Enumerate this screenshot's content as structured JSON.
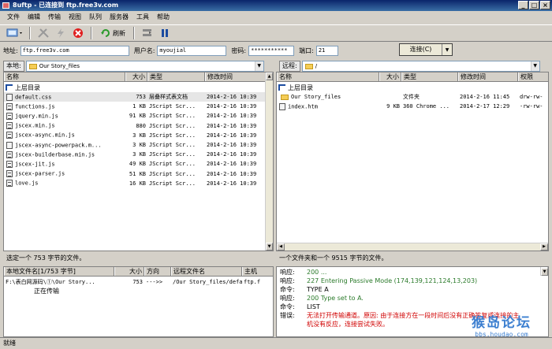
{
  "window": {
    "title": "8uftp - 已连接到 ftp.free3v.com",
    "min": "_",
    "max": "□",
    "close": "×"
  },
  "menu": [
    "文件",
    "编辑",
    "传输",
    "视图",
    "队列",
    "服务器",
    "工具",
    "帮助"
  ],
  "toolbar": {
    "refresh_label": "刷新"
  },
  "addressbar": {
    "address_label": "地址:",
    "address_value": "ftp.free3v.com",
    "user_label": "用户名:",
    "user_value": "myoujial",
    "password_label": "密码:",
    "password_value": "***********",
    "port_label": "端口:",
    "port_value": "21",
    "connect_label": "连接(C)"
  },
  "local": {
    "path_label": "本地:",
    "path_value": "Our Story_files",
    "columns": [
      "名称",
      "大小",
      "类型",
      "修改时间"
    ],
    "up_label": "上层目录",
    "files": [
      {
        "name": "default.css",
        "size": "753",
        "type": "层叠样式表文档",
        "date": "2014-2-16 10:39"
      },
      {
        "name": "functions.js",
        "size": "1 KB",
        "type": "JScript Scr...",
        "date": "2014-2-16 10:39"
      },
      {
        "name": "jquery.min.js",
        "size": "91 KB",
        "type": "JScript Scr...",
        "date": "2014-2-16 10:39"
      },
      {
        "name": "jscex.min.js",
        "size": "880",
        "type": "JScript Scr...",
        "date": "2014-2-16 10:39"
      },
      {
        "name": "jscex-async.min.js",
        "size": "3 KB",
        "type": "JScript Scr...",
        "date": "2014-2-16 10:39"
      },
      {
        "name": "jscex-async-powerpack.m...",
        "size": "3 KB",
        "type": "JScript Scr...",
        "date": "2014-2-16 10:39"
      },
      {
        "name": "jscex-builderbase.min.js",
        "size": "3 KB",
        "type": "JScript Scr...",
        "date": "2014-2-16 10:39"
      },
      {
        "name": "jscex-jit.js",
        "size": "49 KB",
        "type": "JScript Scr...",
        "date": "2014-2-16 10:39"
      },
      {
        "name": "jscex-parser.js",
        "size": "51 KB",
        "type": "JScript Scr...",
        "date": "2014-2-16 10:39"
      },
      {
        "name": "love.js",
        "size": "16 KB",
        "type": "JScript Scr...",
        "date": "2014-2-16 10:39"
      }
    ],
    "status": "选定一个 753 字节的文件。"
  },
  "remote": {
    "path_label": "远程:",
    "path_value": "/",
    "columns": [
      "名称",
      "大小",
      "类型",
      "修改时间",
      "权限"
    ],
    "up_label": "上层目录",
    "files": [
      {
        "name": "Our Story_files",
        "size": "",
        "type": "文件夹",
        "date": "2014-2-16 11:45",
        "perm": "drw-rw-",
        "folder": true
      },
      {
        "name": "index.htm",
        "size": "9 KB",
        "type": "360 Chrome ...",
        "date": "2014-2-17 12:29",
        "perm": "-rw-rw-",
        "folder": false
      }
    ],
    "status": "一个文件夹和一个 9515 字节的文件。"
  },
  "queue": {
    "columns": [
      "本地文件名[1/753 字节]",
      "大小",
      "方向",
      "远程文件名",
      "主机"
    ],
    "items": [
      {
        "local": "F:\\表白网源码\\①\\Our Story...",
        "size": "753",
        "dir": "--->>",
        "remote": "/Our Story_files/defaul...",
        "host": "ftp.f",
        "state": "正在传输"
      }
    ]
  },
  "log": [
    {
      "k": "响应:",
      "v": "200 ...",
      "c": "g"
    },
    {
      "k": "响应:",
      "v": "227 Entering Passive Mode (174,139,121,124,13,203)",
      "c": "g"
    },
    {
      "k": "命令:",
      "v": "TYPE A",
      "c": "k"
    },
    {
      "k": "响应:",
      "v": "200 Type set to A.",
      "c": "g"
    },
    {
      "k": "命令:",
      "v": "LIST",
      "c": "k"
    },
    {
      "k": "错误:",
      "v": "无法打开传输通道。原因: 由于连接方在一段时间后没有正确答复或连接的主",
      "c": "e"
    },
    {
      "k": "",
      "v": "机没有反应，连接尝试失败。",
      "c": "e"
    }
  ],
  "statusbar": "就绪",
  "watermark": {
    "big": "猴岛论坛",
    "small": "bbs.houdao.com"
  }
}
